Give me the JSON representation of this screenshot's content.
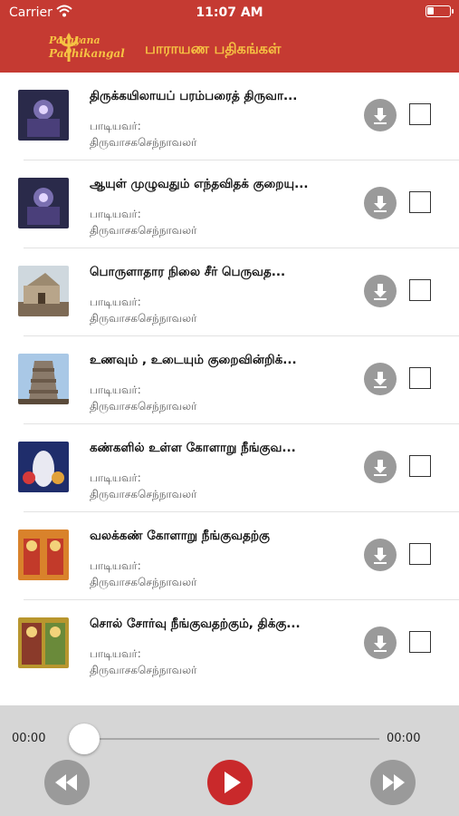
{
  "status_bar": {
    "carrier": "Carrier",
    "time": "11:07 AM"
  },
  "header": {
    "logo_line1": "Parayana",
    "logo_line2": "Padhikangal",
    "title": "பாராயண பதிகங்கள்"
  },
  "songs": [
    {
      "title": "திருக்கயிலாயப் பரம்பரைத் திருவா...",
      "singer_label": "பாடியவர்:",
      "singer": "திருவாசகசெந்நாவலர்",
      "thumb_icon": "shiva-image"
    },
    {
      "title": "ஆயுள் முழுவதும் எந்தவிதக் குறையு...",
      "singer_label": "பாடியவர்:",
      "singer": "திருவாசகசெந்நாவலர்",
      "thumb_icon": "shiva-image"
    },
    {
      "title": "பொருளாதார நிலை சீர் பெருவத...",
      "singer_label": "பாடியவர்:",
      "singer": "திருவாசகசெந்நாவலர்",
      "thumb_icon": "temple-image"
    },
    {
      "title": "உணவும் , உடையும் குறைவின்றிக்...",
      "singer_label": "பாடியவர்:",
      "singer": "திருவாசகசெந்நாவலர்",
      "thumb_icon": "gopuram-image"
    },
    {
      "title": "கண்களில் உள்ள கோளாறு நீங்குவ...",
      "singer_label": "பாடியவர்:",
      "singer": "திருவாசகசெந்நாவலர்",
      "thumb_icon": "deity-image"
    },
    {
      "title": "வலக்கண் கோளாறு நீங்குவதற்கு",
      "singer_label": "பாடியவர்:",
      "singer": "திருவாசகசெந்நாவலர்",
      "thumb_icon": "deity-image"
    },
    {
      "title": "சொல் சோர்வு நீங்குவதற்கும், திக்கு...",
      "singer_label": "பாடியவர்:",
      "singer": "திருவாசகசெந்நாவலர்",
      "thumb_icon": "deity-image"
    }
  ],
  "player": {
    "elapsed": "00:00",
    "duration": "00:00",
    "progress": 0
  },
  "colors": {
    "header": "#c53a32",
    "accent_yellow": "#f6c343",
    "play": "#c9292b",
    "button_grey": "#9a9a9a"
  }
}
